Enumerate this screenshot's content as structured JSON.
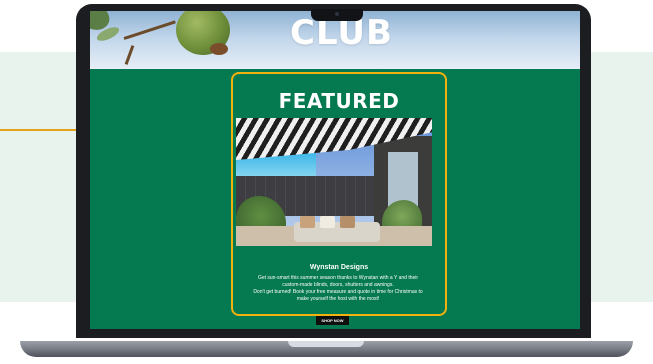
{
  "hero": {
    "title": "CLUB"
  },
  "featured": {
    "title": "FEATURED",
    "heading": "Wynstan Designs",
    "description_lines": [
      "Get sun-smart this summer season thanks to Wynstan with a Y and their",
      "custom-made blinds, doors, shutters and awnings.",
      "Don't get burned! Book your free measure and quote in time for Christmas to",
      "make yourself the host with the most!"
    ],
    "button_label": "SHOP NOW"
  },
  "colors": {
    "screen_green": "#05794f",
    "accent_gold": "#f1b10f",
    "callout_gold": "#e3a31b",
    "background_mint": "#e8f3ee"
  },
  "icons": [
    "laptop-camera-icon",
    "callout-dot-icon"
  ]
}
